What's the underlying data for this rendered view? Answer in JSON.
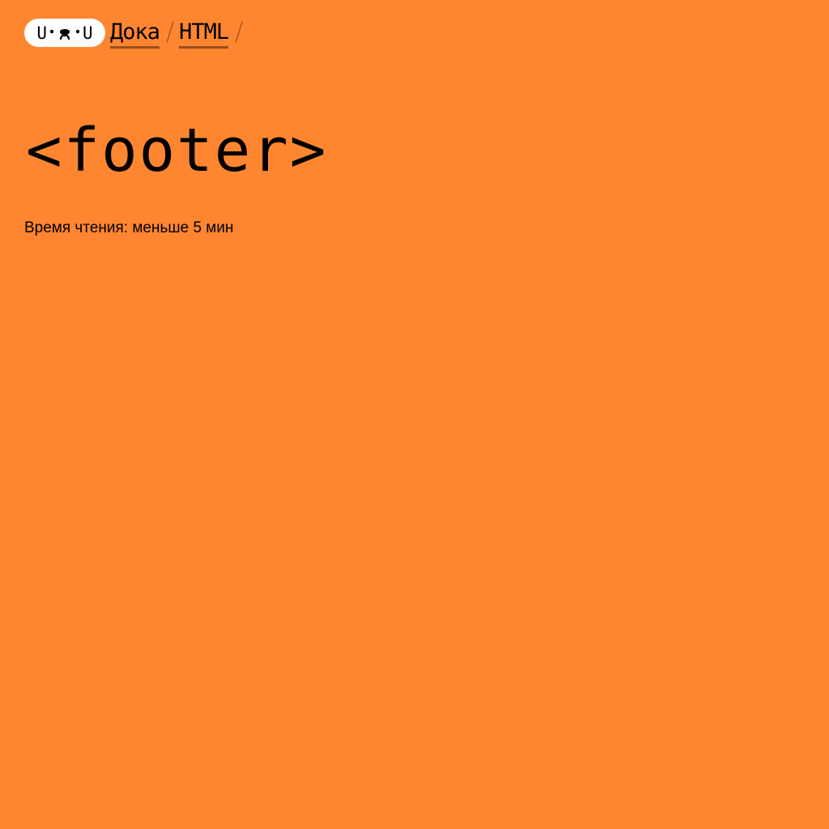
{
  "logo": {
    "left": "U",
    "right": "U",
    "face_icon": "cat-face-icon"
  },
  "breadcrumbs": [
    {
      "label": "Дока"
    },
    {
      "label": "HTML"
    }
  ],
  "breadcrumb_separator": "/",
  "page": {
    "title": "<footer>",
    "reading_time": "Время чтения: меньше 5 мин"
  },
  "colors": {
    "background": "#ff8630",
    "logo_bg": "#ffffff",
    "text": "#000000"
  }
}
